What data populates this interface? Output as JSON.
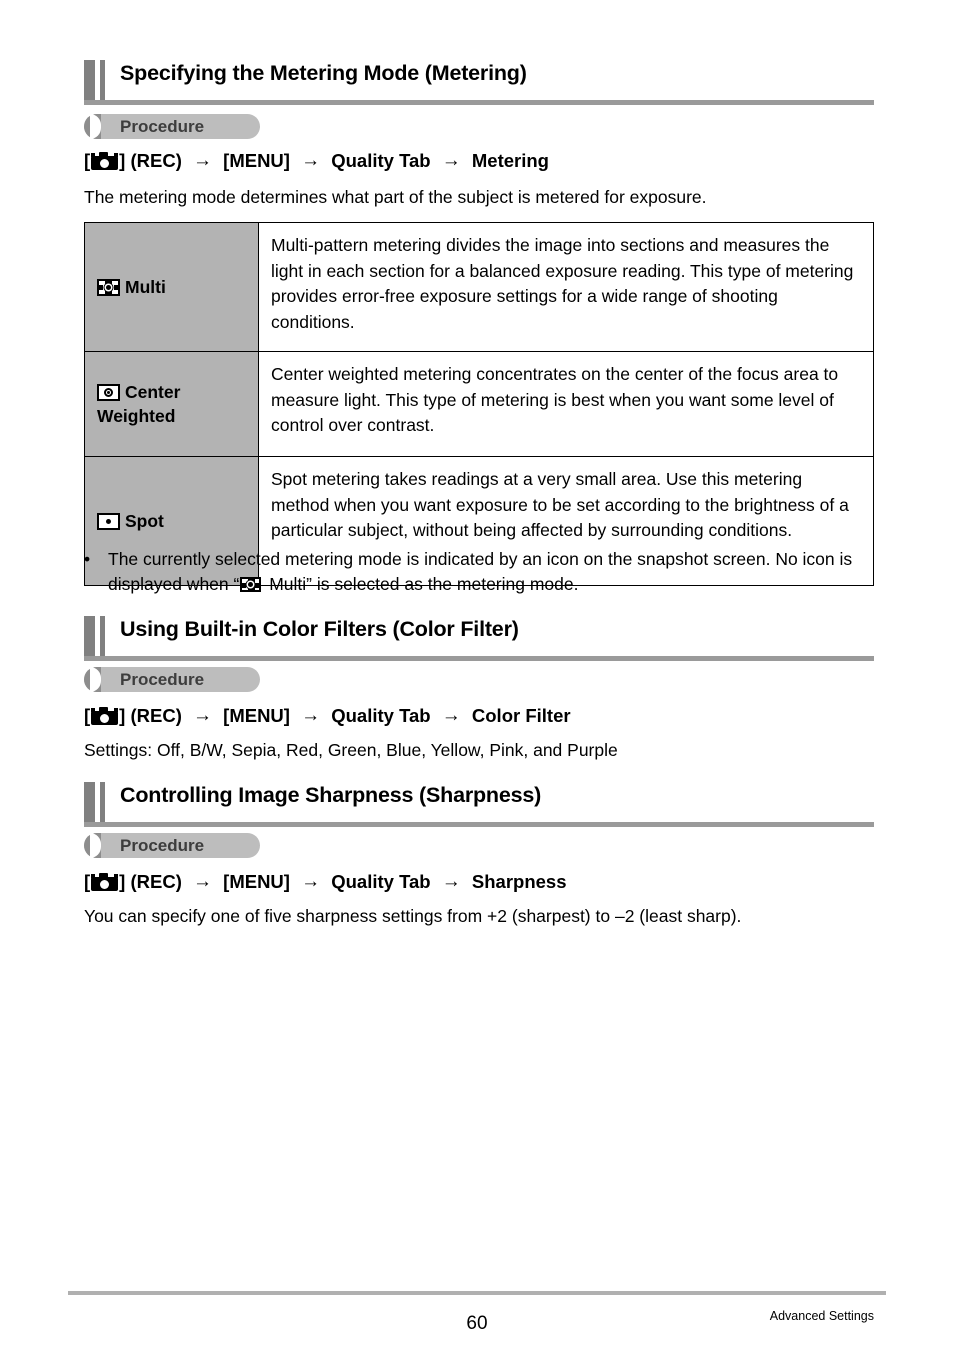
{
  "document": {
    "page_number": "60",
    "footer_label": "Advanced Settings"
  },
  "sections": [
    {
      "heading": "Specifying the Metering Mode (Metering)",
      "procedure_badge": "Procedure",
      "path": {
        "camera_bracket_open": "[",
        "camera_bracket_close": "]",
        "rec": "(REC)",
        "menu": "[MENU]",
        "tab": "Quality Tab",
        "target": "Metering",
        "arrow": "→"
      },
      "intro": "The metering mode determines what part of the subject is metered for exposure."
    },
    {
      "heading": "Using Built-in Color Filters (Color Filter)",
      "procedure_badge": "Procedure",
      "path": {
        "camera_bracket_open": "[",
        "camera_bracket_close": "]",
        "rec": "(REC)",
        "menu": "[MENU]",
        "tab": "Quality Tab",
        "target": "Color Filter",
        "arrow": "→"
      },
      "intro": "Settings: Off, B/W, Sepia, Red, Green, Blue, Yellow, Pink, and Purple"
    },
    {
      "heading": "Controlling Image Sharpness (Sharpness)",
      "procedure_badge": "Procedure",
      "path": {
        "camera_bracket_open": "[",
        "camera_bracket_close": "]",
        "rec": "(REC)",
        "menu": "[MENU]",
        "tab": "Quality Tab",
        "target": "Sharpness",
        "arrow": "→"
      },
      "intro": "You can specify one of five sharpness settings from +2 (sharpest) to –2 (least sharp)."
    }
  ],
  "metering_table": {
    "rows": [
      {
        "icon": "metering-multi-icon",
        "label": "Multi",
        "description": "Multi-pattern metering divides the image into sections and measures the light in each section for a balanced exposure reading. This type of metering provides error-free exposure settings for a wide range of shooting conditions."
      },
      {
        "icon": "metering-center-weighted-icon",
        "label": "Center Weighted",
        "description": "Center weighted metering concentrates on the center of the focus area to measure light. This type of metering is best when you want some level of control over contrast."
      },
      {
        "icon": "metering-spot-icon",
        "label": "Spot",
        "description": "Spot metering takes readings at a very small area. Use this metering method when you want exposure to be set according to the brightness of a particular subject, without being affected by surrounding conditions."
      }
    ]
  },
  "note": {
    "bullet": "•",
    "text_before_icon": "The currently selected metering mode is indicated by an icon on the snapshot screen. No icon is displayed when “",
    "icon": "metering-multi-icon",
    "text_after_icon": " Multi” is selected as the metering mode."
  },
  "colors": {
    "heading_bar": "#808080",
    "heading_rule": "#9a9a9a",
    "badge_pill": "#bdbdbd",
    "badge_cap": "#8d8d8d",
    "table_label_bg": "#b3b3b3",
    "footer_rule": "#b0b0b0"
  }
}
